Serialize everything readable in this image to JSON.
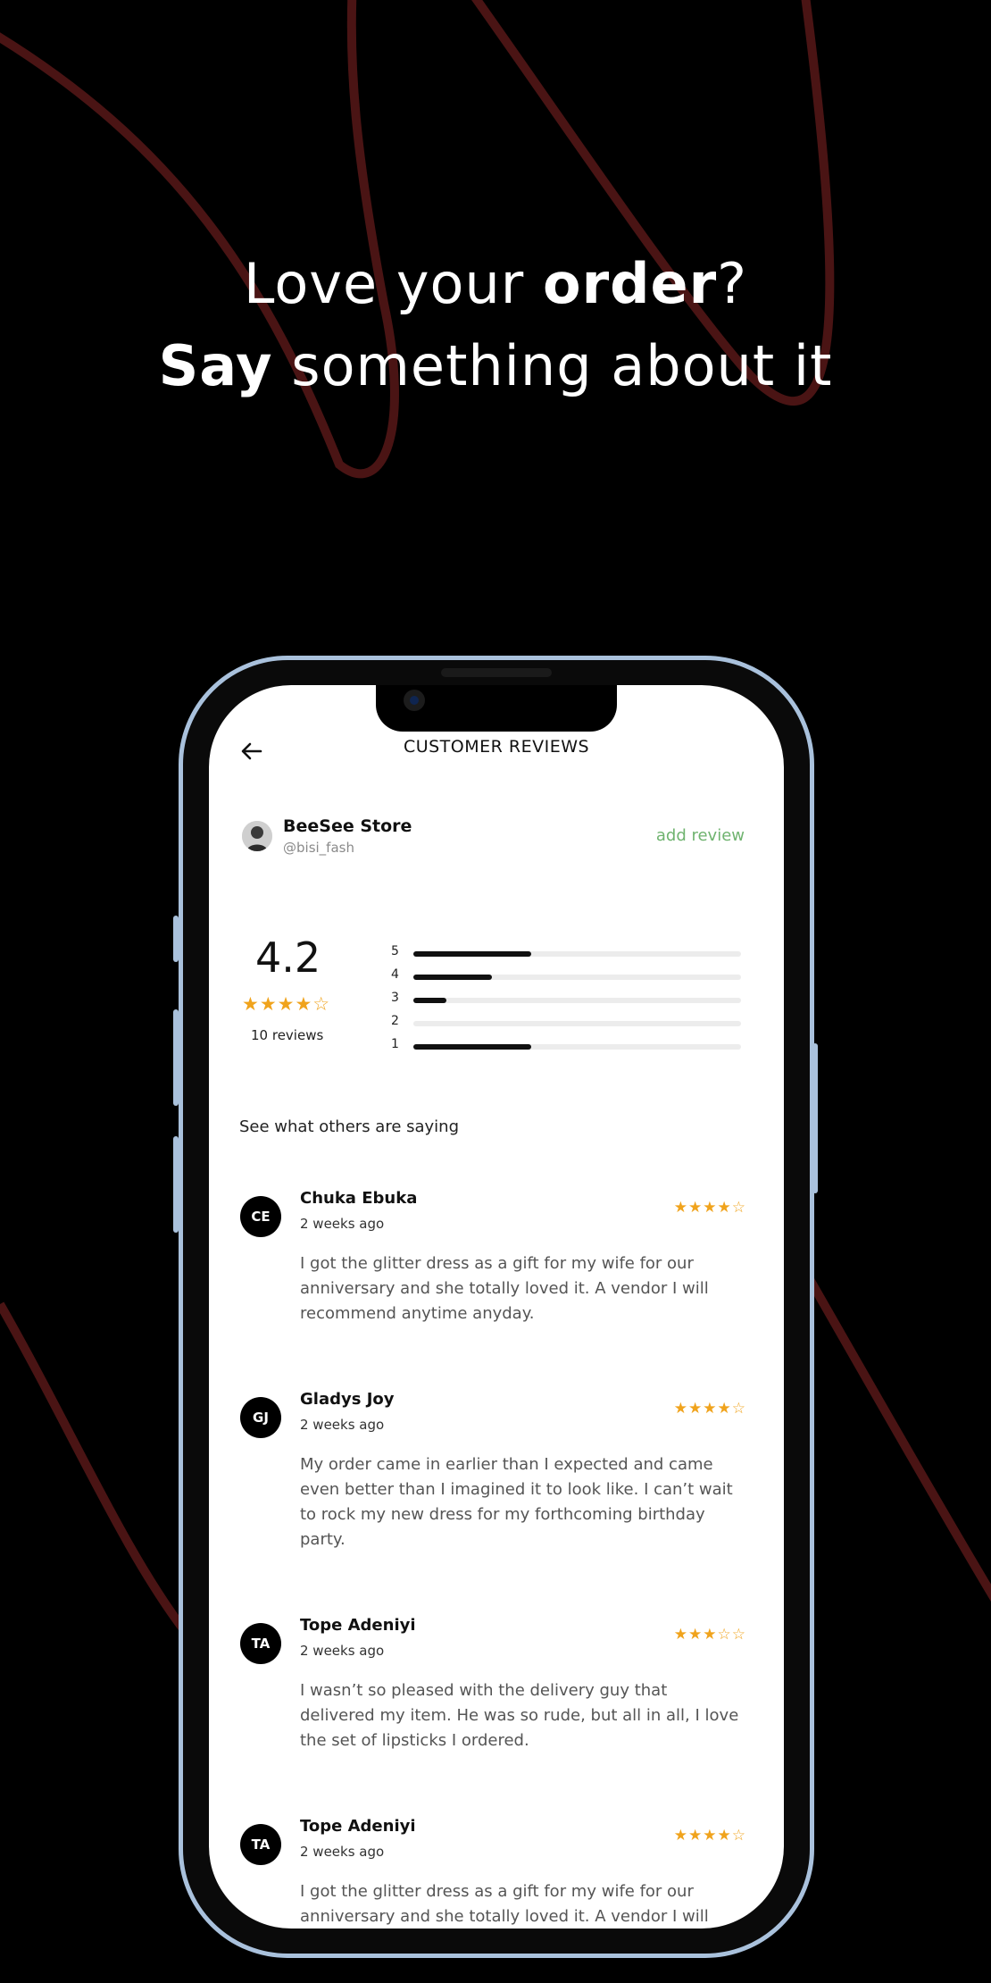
{
  "headline": {
    "line1_pre": "Love your ",
    "line1_bold": "order",
    "line1_post": "?",
    "line2_bold": "Say",
    "line2_post": " something about it"
  },
  "screen": {
    "title": "CUSTOMER REVIEWS",
    "store": {
      "name": "BeeSee Store",
      "handle": "@bisi_fash"
    },
    "add_review_label": "add review",
    "rating": {
      "value": "4.2",
      "stars": "★★★★☆",
      "count_label": "10 reviews",
      "distribution": [
        {
          "label": "5",
          "fraction": 0.36
        },
        {
          "label": "4",
          "fraction": 0.24
        },
        {
          "label": "3",
          "fraction": 0.1
        },
        {
          "label": "2",
          "fraction": 0.0
        },
        {
          "label": "1",
          "fraction": 0.36
        }
      ]
    },
    "section_title": "See what others are saying",
    "reviews": [
      {
        "initials": "CE",
        "name": "Chuka Ebuka",
        "time": "2 weeks ago",
        "stars": "★★★★☆",
        "text": "I got the glitter dress as a gift for my wife for our anniversary and she totally loved it. A vendor I will recommend anytime anyday."
      },
      {
        "initials": "GJ",
        "name": "Gladys Joy",
        "time": "2 weeks ago",
        "stars": "★★★★☆",
        "text": "My order came in earlier than I expected and came even better than I imagined it to look like. I can’t wait to rock my new dress for my forthcoming birthday party."
      },
      {
        "initials": "TA",
        "name": "Tope Adeniyi",
        "time": "2 weeks ago",
        "stars": "★★★☆☆",
        "text": "I wasn’t so pleased with the delivery guy that delivered my item. He was so rude, but all in all, I love the set of lipsticks I ordered."
      },
      {
        "initials": "TA",
        "name": "Tope Adeniyi",
        "time": "2 weeks ago",
        "stars": "★★★★☆",
        "text": "I got the glitter dress as a gift for my wife for our anniversary and she totally loved it. A vendor I will"
      }
    ]
  },
  "colors": {
    "accent_green": "#6fb36f",
    "star": "#f0a31c",
    "curve": "#4a1414",
    "phone_frame": "#a9c1dc"
  }
}
